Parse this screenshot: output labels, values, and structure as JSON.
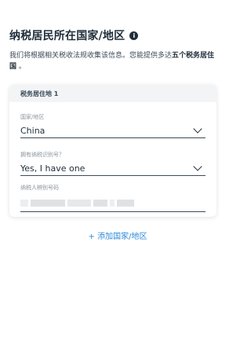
{
  "header": {
    "title": "纳税居民所在国家/地区",
    "info_icon_glyph": "i"
  },
  "description": {
    "text": "我们将根据相关税收法规收集该信息。您能提供多达",
    "bold": "五个税务居住国",
    "suffix": " 。"
  },
  "card": {
    "header_label": "税务居住地 1",
    "country": {
      "label": "国家/地区",
      "value": "China"
    },
    "tin_status": {
      "label": "拥有纳税识别号？",
      "value": "Yes, I have one"
    },
    "tin": {
      "label": "纳税人辨别号码"
    }
  },
  "add_link": {
    "label": "+ 添加国家/地区"
  },
  "colors": {
    "accent_link": "#2b8ad8",
    "text_primary": "#1f2d3a",
    "card_header_bg": "#f2f4f6"
  }
}
